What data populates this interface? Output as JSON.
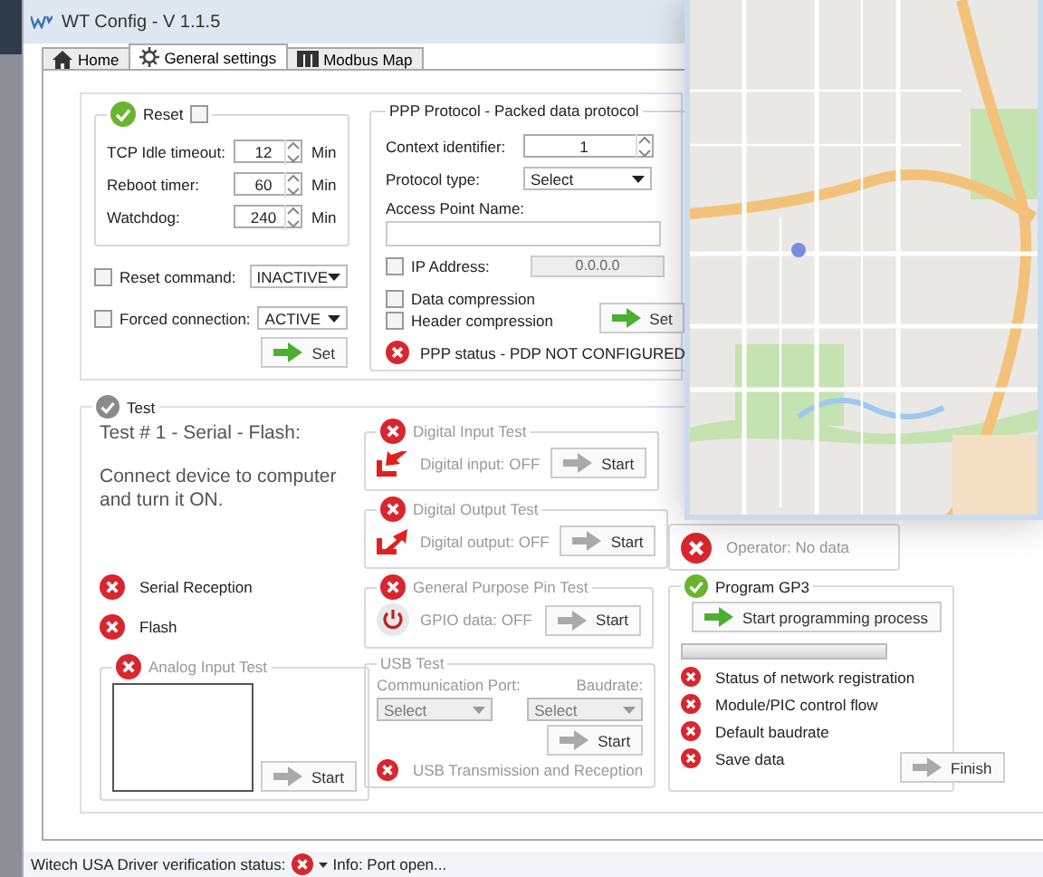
{
  "window": {
    "title": "WT Config - V 1.1.5"
  },
  "tabs": [
    {
      "label": "Home",
      "selected": false
    },
    {
      "label": "General settings",
      "selected": true
    },
    {
      "label": "Modbus Map",
      "selected": false
    }
  ],
  "reset_group": {
    "title": "Reset",
    "ok": true,
    "checked": false,
    "fields": [
      {
        "label": "TCP Idle timeout:",
        "value": "12",
        "unit": "Min"
      },
      {
        "label": "Reboot timer:",
        "value": "60",
        "unit": "Min"
      },
      {
        "label": "Watchdog:",
        "value": "240",
        "unit": "Min"
      }
    ]
  },
  "commands": [
    {
      "label": "Reset command:",
      "checked": false,
      "value": "INACTIVE"
    },
    {
      "label": "Forced connection:",
      "checked": false,
      "value": "ACTIVE"
    }
  ],
  "set_button": "Set",
  "ppp": {
    "title": "PPP Protocol - Packed data protocol",
    "context_label": "Context identifier:",
    "context_value": "1",
    "protocol_label": "Protocol type:",
    "protocol_value": "Select",
    "apn_label": "Access Point Name:",
    "ip": {
      "label": "IP Address:",
      "checked": false,
      "value": "0.0.0.0"
    },
    "options": [
      {
        "label": "Data compression",
        "checked": false
      },
      {
        "label": "Header compression",
        "checked": false
      }
    ],
    "set_button": "Set",
    "status": "PPP status - PDP NOT CONFIGURED",
    "status_ok": false
  },
  "test": {
    "title": "Test",
    "heading": "Test # 1 - Serial - Flash:",
    "instruction": "Connect device to computer and turn it ON.",
    "results": [
      {
        "label": "Serial Reception",
        "ok": false
      },
      {
        "label": "Flash",
        "ok": false
      }
    ],
    "analog": {
      "title": "Analog Input Test",
      "ok": false,
      "button": "Start"
    },
    "io_tests": [
      {
        "kind": "input",
        "title": "Digital Input Test",
        "ok": false,
        "reading": "Digital input: OFF",
        "button": "Start"
      },
      {
        "kind": "output",
        "title": "Digital Output Test",
        "ok": false,
        "reading": "Digital output: OFF",
        "button": "Start"
      },
      {
        "kind": "gpio",
        "title": "General Purpose Pin Test",
        "ok": false,
        "reading": "GPIO data: OFF",
        "button": "Start"
      }
    ],
    "usb": {
      "title": "USB Test",
      "port_label": "Communication Port:",
      "port_value": "Select",
      "baud_label": "Baudrate:",
      "baud_value": "Select",
      "button": "Start",
      "result": "USB Transmission and Reception",
      "ok": false
    },
    "operator": {
      "text": "Operator: No data",
      "ok": false
    },
    "program": {
      "title": "Program GP3",
      "ok": true,
      "button": "Start programming process",
      "level": 0,
      "steps": [
        {
          "label": "Status of network registration",
          "ok": false
        },
        {
          "label": "Module/PIC control flow",
          "ok": false
        },
        {
          "label": "Default baudrate",
          "ok": false
        },
        {
          "label": "Save data",
          "ok": false
        }
      ]
    },
    "finish_button": "Finish"
  },
  "status_bar": {
    "label": "Witech USA Driver verification status:",
    "ok": false,
    "info": "Info: Port open..."
  }
}
